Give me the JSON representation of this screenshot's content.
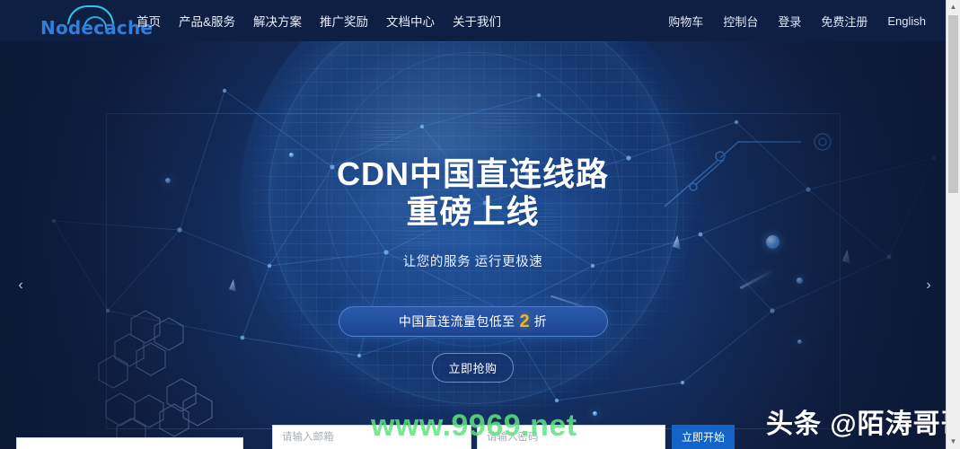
{
  "brand": {
    "logo_text": "Nodecache",
    "logo_color": "#2f7fe0",
    "cloud_color": "#2ec8e6"
  },
  "header": {
    "nav_left": [
      {
        "label": "首页"
      },
      {
        "label": "产品&服务"
      },
      {
        "label": "解决方案"
      },
      {
        "label": "推广奖励"
      },
      {
        "label": "文档中心"
      },
      {
        "label": "关于我们"
      }
    ],
    "nav_right": [
      {
        "label": "购物车"
      },
      {
        "label": "控制台"
      },
      {
        "label": "登录"
      },
      {
        "label": "免费注册"
      },
      {
        "label": "English"
      }
    ]
  },
  "hero": {
    "title_line1": "CDN中国直连线路",
    "title_line2": "重磅上线",
    "subtitle": "让您的服务 运行更极速",
    "promo_prefix": "中国直连流量包低至",
    "promo_number": "2",
    "promo_suffix": "折",
    "promo_number_color": "#f0b429",
    "buy_button": "立即抢购",
    "arrow_prev": "‹",
    "arrow_next": "›"
  },
  "signup_form": {
    "email_placeholder": "请输入邮箱",
    "email_value": "",
    "password_placeholder": "请输入密码",
    "password_value": "",
    "start_button": "立即开始",
    "button_color": "#1464c8"
  },
  "watermarks": {
    "site": "www.9969.net",
    "site_color": "#60e280",
    "author": "头条 @陌涛哥哥"
  },
  "scrollbar": {
    "up_arrow": "▲",
    "down_arrow": "▼"
  }
}
